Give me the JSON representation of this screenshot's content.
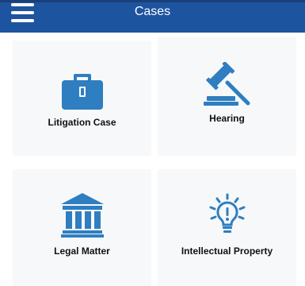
{
  "appbar": {
    "title": "Cases"
  },
  "tiles": [
    {
      "label": "Litigation Case",
      "icon": "briefcase-icon"
    },
    {
      "label": "Hearing",
      "icon": "gavel-icon"
    },
    {
      "label": "Legal Matter",
      "icon": "courthouse-icon"
    },
    {
      "label": "Intellectual Property",
      "icon": "lightbulb-icon"
    }
  ],
  "colors": {
    "appbar": "#1d54a0",
    "icon": "#2e7ec1",
    "tile": "#f7f8f9"
  }
}
